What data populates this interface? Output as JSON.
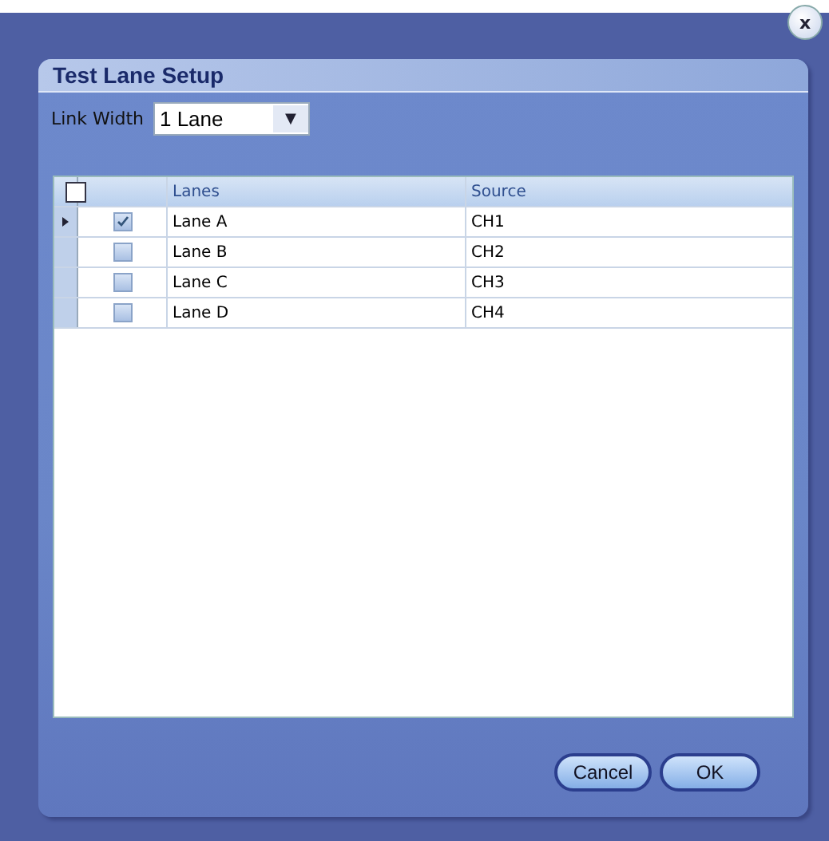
{
  "window": {
    "title": "Test Lane Setup"
  },
  "link_width": {
    "label": "Link Width",
    "value": "1 Lane",
    "arrow": "▼"
  },
  "table": {
    "select_all_checked": false,
    "columns": [
      "Lanes",
      "Source"
    ],
    "rows": [
      {
        "lane": "Lane A",
        "source": "CH1",
        "checked": true,
        "selected": true
      },
      {
        "lane": "Lane B",
        "source": "CH2",
        "checked": false,
        "selected": false
      },
      {
        "lane": "Lane C",
        "source": "CH3",
        "checked": false,
        "selected": false
      },
      {
        "lane": "Lane D",
        "source": "CH4",
        "checked": false,
        "selected": false
      }
    ]
  },
  "close": "x",
  "buttons": [
    "Cancel",
    "OK"
  ]
}
